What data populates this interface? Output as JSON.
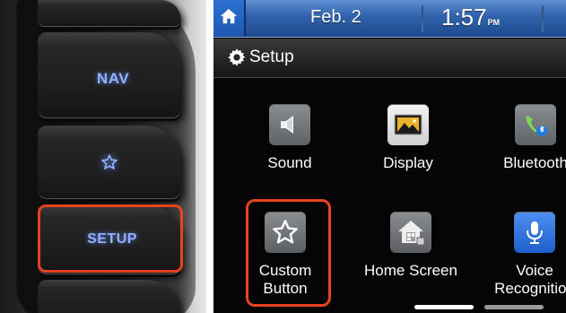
{
  "console": {
    "nav_label": "NAV",
    "setup_label": "SETUP",
    "star_icon": "star-outline-icon"
  },
  "screen": {
    "status_bar": {
      "home_icon": "home-icon",
      "date": "Feb.  2",
      "time": "1:57",
      "ampm": "PM"
    },
    "title_bar": {
      "icon": "gear-icon",
      "title": "Setup"
    },
    "tiles": [
      {
        "label": "Sound",
        "icon": "speaker-icon"
      },
      {
        "label": "Display",
        "icon": "display-icon"
      },
      {
        "label": "Bluetooth",
        "icon": "bluetooth-phone-icon"
      },
      {
        "label": "Custom Button",
        "icon": "star-icon"
      },
      {
        "label": "Home Screen",
        "icon": "home-screen-icon"
      },
      {
        "label": "Voice Recognition",
        "icon": "microphone-icon"
      }
    ],
    "page_indicator": {
      "pages": 2,
      "current": 1
    }
  },
  "colors": {
    "highlight": "#e8431f",
    "status_bar": "#2f62ab",
    "key_glow": "#8fb1ff"
  }
}
